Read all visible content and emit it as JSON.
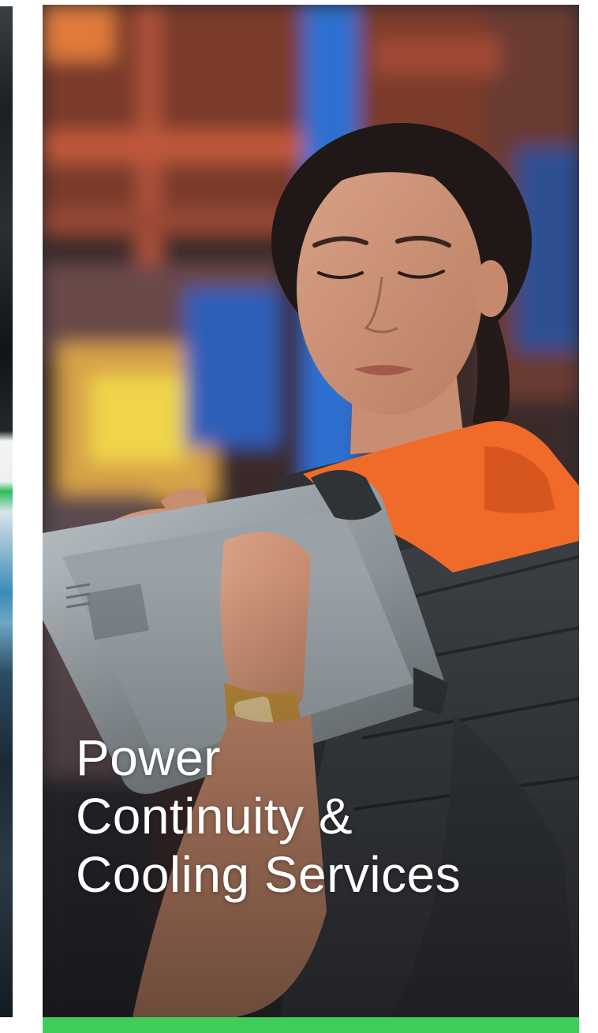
{
  "tile": {
    "title_lines": [
      "Power",
      "Continuity &",
      "Cooling Services"
    ]
  },
  "photo": {
    "icon": "person-with-tablet-photo"
  },
  "colors": {
    "accent": "#3dcd58",
    "vest_orange": "#f06a2a",
    "background": "#ffffff",
    "title_text": "#ffffff"
  }
}
